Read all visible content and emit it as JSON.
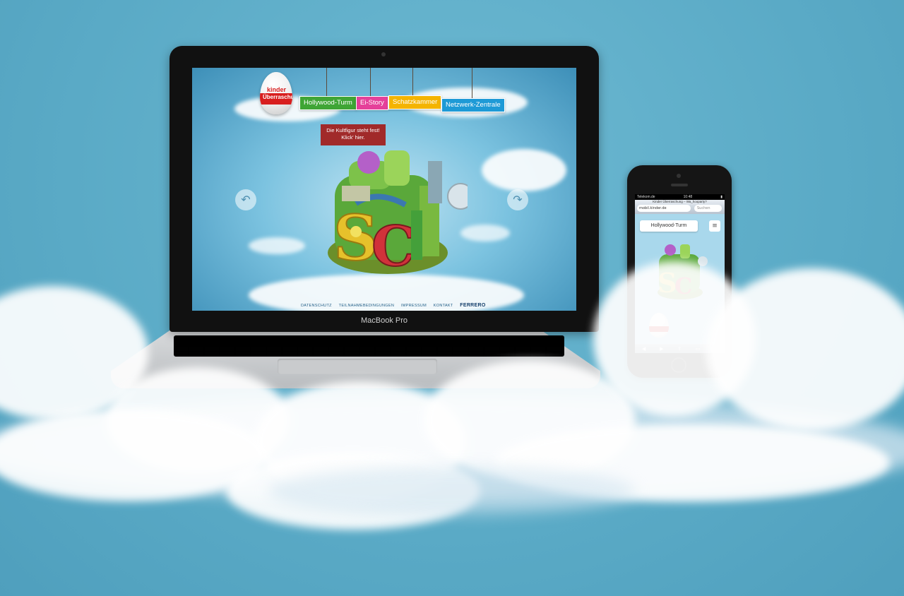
{
  "colors": {
    "background": "#5eaec8",
    "nav_green": "#3fa535",
    "nav_pink": "#e5409a",
    "nav_yellow": "#f4b400",
    "nav_blue": "#1e9ad6",
    "promo_red": "#a12a2a",
    "kinder_red": "#d81e1e"
  },
  "laptop": {
    "brand_label": "MacBook Pro",
    "site": {
      "logo_kinder": "kinder",
      "logo_product": "Überraschung",
      "nav": [
        {
          "label": "Hollywood-Turm",
          "color": "#3fa535"
        },
        {
          "label": "Ei-Story",
          "color": "#e5409a"
        },
        {
          "label": "Schatzkammer",
          "color": "#f4b400"
        },
        {
          "label": "Netzwerk-Zentrale",
          "color": "#1e9ad6"
        }
      ],
      "promo": "Die Kultfigur steht fest! Klick' hier.",
      "island_letters": "SCI",
      "arrow_left_icon": "back-arrow-icon",
      "arrow_right_icon": "forward-arrow-icon",
      "footer": [
        "DATENSCHUTZ",
        "TEILNAHMEBEDINGUNGEN",
        "IMPRESSUM",
        "KONTAKT",
        "FERRERO"
      ]
    }
  },
  "phone": {
    "status_carrier": "Telekom.de",
    "status_time": "10:48",
    "page_title": "Kinder Überraschung – Wa_hooparty?",
    "url": "mobil.kinder.de",
    "search_placeholder": "Suchen",
    "menu_label": "Hollywood-Turm",
    "menu_icon": "hamburger-icon",
    "toolbar": [
      "◀",
      "▶",
      "⇪",
      "▭",
      "⧉"
    ]
  }
}
